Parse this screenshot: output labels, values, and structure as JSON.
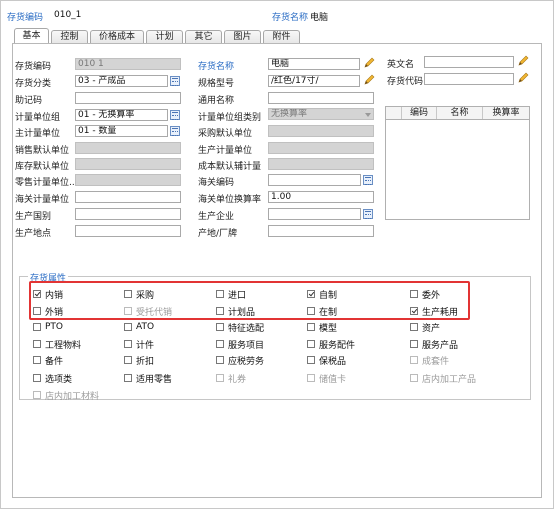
{
  "header": {
    "code_label": "存货编码",
    "code_value": "010_1",
    "name_label": "存货名称",
    "name_value": "电脑"
  },
  "tabs": [
    "基本",
    "控制",
    "价格成本",
    "计划",
    "其它",
    "图片",
    "附件"
  ],
  "active_tab": "基本",
  "left_fields": [
    {
      "label": "存货编码",
      "value": "010 1",
      "label_blue": true,
      "disabled": true,
      "picker": false
    },
    {
      "label": "存货分类",
      "value": "03 - 产成品",
      "label_blue": true,
      "disabled": false,
      "picker": true
    },
    {
      "label": "助记码",
      "value": "",
      "label_blue": false,
      "disabled": false,
      "picker": false
    },
    {
      "label": "计量单位组",
      "value": "01 - 无换算率",
      "label_blue": true,
      "disabled": false,
      "picker": true
    },
    {
      "label": "主计量单位",
      "value": "01 - 数量",
      "label_blue": true,
      "disabled": false,
      "picker": true
    },
    {
      "label": "销售默认单位",
      "value": "",
      "label_blue": false,
      "disabled": true,
      "picker": false
    },
    {
      "label": "库存默认单位",
      "value": "",
      "label_blue": false,
      "disabled": true,
      "picker": false
    },
    {
      "label": "零售计量单位...",
      "value": "",
      "label_blue": false,
      "disabled": true,
      "picker": false
    },
    {
      "label": "海关计量单位",
      "value": "",
      "label_blue": false,
      "disabled": false,
      "picker": false
    },
    {
      "label": "生产国别",
      "value": "",
      "label_blue": false,
      "disabled": false,
      "picker": false
    },
    {
      "label": "生产地点",
      "value": "",
      "label_blue": false,
      "disabled": false,
      "picker": false
    }
  ],
  "mid_fields": [
    {
      "label": "存货名称",
      "value": "电脑",
      "label_blue": true,
      "disabled": false,
      "picker": false,
      "edit": true
    },
    {
      "label": "规格型号",
      "value": "/红色/17寸/",
      "label_blue": false,
      "disabled": false,
      "picker": false,
      "edit": true
    },
    {
      "label": "通用名称",
      "value": "",
      "label_blue": false,
      "disabled": false,
      "picker": false,
      "edit": false
    },
    {
      "label": "计量单位组类别",
      "value": "无换算率",
      "label_blue": false,
      "disabled": true,
      "picker": false,
      "edit": false,
      "dropdown": true
    },
    {
      "label": "采购默认单位",
      "value": "",
      "label_blue": false,
      "disabled": true,
      "picker": false,
      "edit": false
    },
    {
      "label": "生产计量单位",
      "value": "",
      "label_blue": false,
      "disabled": true,
      "picker": false,
      "edit": false
    },
    {
      "label": "成本默认辅计量",
      "value": "",
      "label_blue": false,
      "disabled": true,
      "picker": false,
      "edit": false
    },
    {
      "label": "海关编码",
      "value": "",
      "label_blue": false,
      "disabled": false,
      "picker": true,
      "edit": false
    },
    {
      "label": "海关单位换算率",
      "value": "1.00",
      "label_blue": false,
      "disabled": false,
      "picker": false,
      "edit": false
    },
    {
      "label": "生产企业",
      "value": "",
      "label_blue": false,
      "disabled": false,
      "picker": true,
      "edit": false
    },
    {
      "label": "产地/厂牌",
      "value": "",
      "label_blue": false,
      "disabled": false,
      "picker": false,
      "edit": false
    }
  ],
  "right_fields": [
    {
      "label": "英文名",
      "value": "",
      "edit": true
    },
    {
      "label": "存货代码",
      "value": "",
      "edit": true
    }
  ],
  "grid": {
    "columns": [
      "编码",
      "名称",
      "换算率"
    ]
  },
  "attributes": {
    "title": "存货属性",
    "rows": [
      [
        {
          "label": "内销",
          "checked": true,
          "enabled": true
        },
        {
          "label": "采购",
          "checked": false,
          "enabled": true
        },
        {
          "label": "进口",
          "checked": false,
          "enabled": true
        },
        {
          "label": "自制",
          "checked": true,
          "enabled": true
        },
        {
          "label": "委外",
          "checked": false,
          "enabled": true
        }
      ],
      [
        {
          "label": "外销",
          "checked": false,
          "enabled": true
        },
        {
          "label": "受托代销",
          "checked": false,
          "enabled": false
        },
        {
          "label": "计划品",
          "checked": false,
          "enabled": true
        },
        {
          "label": "在制",
          "checked": false,
          "enabled": true
        },
        {
          "label": "生产耗用",
          "checked": true,
          "enabled": true
        }
      ],
      [
        {
          "label": "PTO",
          "checked": false,
          "enabled": true
        },
        {
          "label": "ATO",
          "checked": false,
          "enabled": true
        },
        {
          "label": "特征选配",
          "checked": false,
          "enabled": true
        },
        {
          "label": "模型",
          "checked": false,
          "enabled": true
        },
        {
          "label": "资产",
          "checked": false,
          "enabled": true
        }
      ],
      [
        {
          "label": "工程物料",
          "checked": false,
          "enabled": true
        },
        {
          "label": "计件",
          "checked": false,
          "enabled": true
        },
        {
          "label": "服务项目",
          "checked": false,
          "enabled": true
        },
        {
          "label": "服务配件",
          "checked": false,
          "enabled": true
        },
        {
          "label": "服务产品",
          "checked": false,
          "enabled": true
        }
      ],
      [
        {
          "label": "备件",
          "checked": false,
          "enabled": true
        },
        {
          "label": "折扣",
          "checked": false,
          "enabled": true
        },
        {
          "label": "应税劳务",
          "checked": false,
          "enabled": true
        },
        {
          "label": "保税品",
          "checked": false,
          "enabled": true
        },
        {
          "label": "成套件",
          "checked": false,
          "enabled": false
        }
      ],
      [
        {
          "label": "选项类",
          "checked": false,
          "enabled": true
        },
        {
          "label": "适用零售",
          "checked": false,
          "enabled": true
        },
        {
          "label": "礼券",
          "checked": false,
          "enabled": false
        },
        {
          "label": "储值卡",
          "checked": false,
          "enabled": false
        },
        {
          "label": "店内加工产品",
          "checked": false,
          "enabled": false
        }
      ],
      [
        {
          "label": "店内加工材料",
          "checked": false,
          "enabled": false
        }
      ]
    ]
  },
  "colors": {
    "accent_blue": "#2a6cc4",
    "highlight_red": "#e23434",
    "disabled_fill": "#d4d4d4"
  }
}
